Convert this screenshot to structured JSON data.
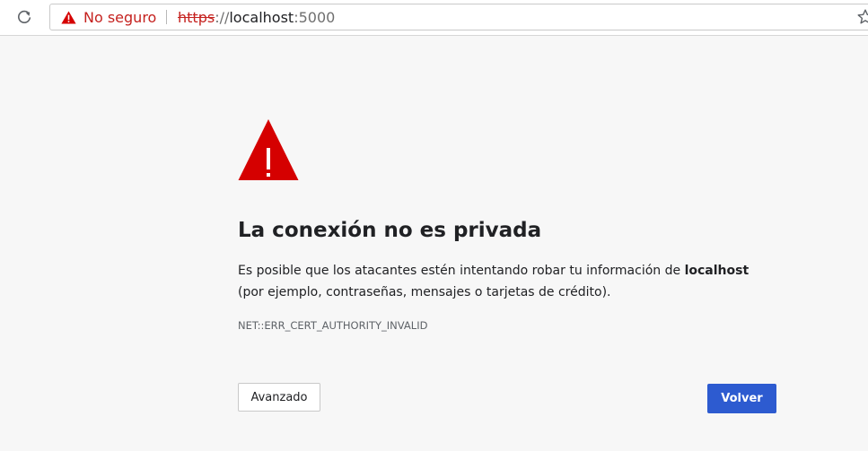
{
  "browser": {
    "security_label": "No seguro",
    "url": {
      "scheme": "https",
      "separator": "://",
      "host": "localhost",
      "port": ":5000"
    },
    "icons": {
      "reload": "reload-icon",
      "security": "warning-triangle-icon",
      "bookmark": "star-icon"
    }
  },
  "interstitial": {
    "title": "La conexión no es privada",
    "explanation_pre": "Es posible que los atacantes estén intentando robar tu información de ",
    "explanation_host": "localhost",
    "explanation_post": " (por ejemplo, contraseñas, mensajes o tarjetas de crédito).",
    "error_code": "NET::ERR_CERT_AUTHORITY_INVALID",
    "advanced_label": "Avanzado",
    "back_label": "Volver",
    "icon": "warning-triangle-icon"
  },
  "colors": {
    "background": "#f7f7f7",
    "warning_red": "#d50000",
    "insecure_text": "#c5221f",
    "primary_button": "#2d5bd0"
  }
}
